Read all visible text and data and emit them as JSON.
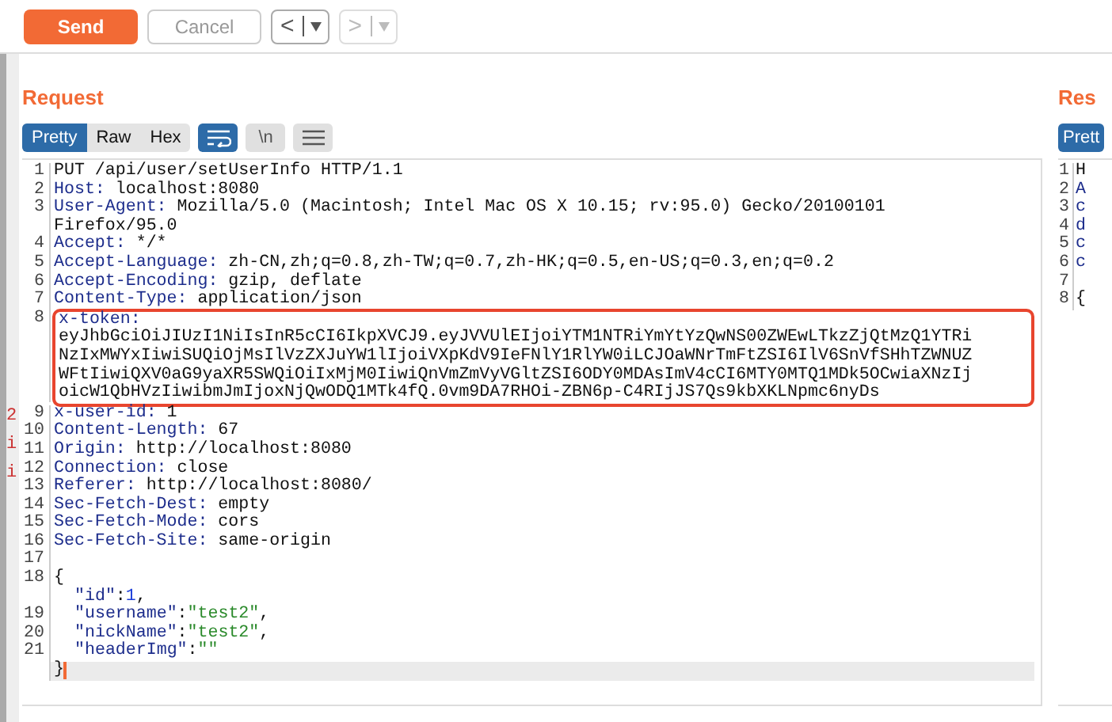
{
  "toolbar": {
    "send": {
      "label": "Send"
    },
    "cancel": {
      "label": "Cancel",
      "disabled": true
    },
    "back": {
      "label": "<",
      "disabled": false
    },
    "forward": {
      "label": ">",
      "disabled": true
    }
  },
  "edge_marks": [
    "2",
    "i",
    "i"
  ],
  "request": {
    "title": "Request",
    "tabs": [
      {
        "label": "Pretty",
        "selected": true
      },
      {
        "label": "Raw",
        "selected": false
      },
      {
        "label": "Hex",
        "selected": false
      }
    ],
    "wrap_toggle": {
      "on": true
    },
    "newline_toggle": {
      "label": "\\n",
      "on": false
    },
    "lines": [
      {
        "kind": "line",
        "number": "1",
        "parts": [
          {
            "kind": "text",
            "text": "PUT /api/user/setUserInfo HTTP/1.1"
          }
        ]
      },
      {
        "kind": "line",
        "number": "2",
        "parts": [
          {
            "kind": "key",
            "text": "Host:"
          },
          {
            "kind": "text",
            "text": " localhost:8080"
          }
        ]
      },
      {
        "kind": "line",
        "number": "3",
        "parts": [
          {
            "kind": "key",
            "text": "User-Agent:"
          },
          {
            "kind": "text",
            "text": " Mozilla/5.0 (Macintosh; Intel Mac OS X 10.15; rv:95.0) Gecko/20100101"
          }
        ]
      },
      {
        "kind": "line",
        "parts": [
          {
            "kind": "text",
            "text": "Firefox/95.0"
          }
        ]
      },
      {
        "kind": "line",
        "number": "4",
        "parts": [
          {
            "kind": "key",
            "text": "Accept:"
          },
          {
            "kind": "text",
            "text": " */*"
          }
        ]
      },
      {
        "kind": "line",
        "number": "5",
        "parts": [
          {
            "kind": "key",
            "text": "Accept-Language:"
          },
          {
            "kind": "text",
            "text": " zh-CN,zh;q=0.8,zh-TW;q=0.7,zh-HK;q=0.5,en-US;q=0.3,en;q=0.2"
          }
        ]
      },
      {
        "kind": "line",
        "number": "6",
        "parts": [
          {
            "kind": "key",
            "text": "Accept-Encoding:"
          },
          {
            "kind": "text",
            "text": " gzip, deflate"
          }
        ]
      },
      {
        "kind": "line",
        "number": "7",
        "parts": [
          {
            "kind": "key",
            "text": "Content-Type:"
          },
          {
            "kind": "text",
            "text": " application/json"
          }
        ]
      },
      {
        "kind": "boxed",
        "lines": [
          {
            "number": "8",
            "parts": [
              {
                "kind": "key",
                "text": "x-token:"
              }
            ]
          },
          {
            "parts": [
              {
                "kind": "text",
                "text": "eyJhbGciOiJIUzI1NiIsInR5cCI6IkpXVCJ9.eyJVVUlEIjoiYTM1NTRiYmYtYzQwNS00ZWEwLTkzZjQtMzQ1YTRi"
              }
            ]
          },
          {
            "parts": [
              {
                "kind": "text",
                "text": "NzIxMWYxIiwiSUQiOjMsIlVzZXJuYW1lIjoiVXpKdV9IeFNlY1RlYW0iLCJOaWNrTmFtZSI6IlV6SnVfSHhTZWNUZ"
              }
            ]
          },
          {
            "parts": [
              {
                "kind": "text",
                "text": "WFtIiwiQXV0aG9yaXR5SWQiOiIxMjM0IiwiQnVmZmVyVGltZSI6ODY0MDAsImV4cCI6MTY0MTQ1MDk5OCwiaXNzIj"
              }
            ]
          },
          {
            "parts": [
              {
                "kind": "text",
                "text": "oicW1QbHVzIiwibmJmIjoxNjQwODQ1MTk4fQ.0vm9DA7RHOi-ZBN6p-C4RIjJS7Qs9kbXKLNpmc6nyDs"
              }
            ]
          }
        ]
      },
      {
        "kind": "line",
        "number": "9",
        "parts": [
          {
            "kind": "key",
            "text": "x-user-id:"
          },
          {
            "kind": "text",
            "text": " 1"
          }
        ]
      },
      {
        "kind": "line",
        "number": "10",
        "parts": [
          {
            "kind": "key",
            "text": "Content-Length:"
          },
          {
            "kind": "text",
            "text": " 67"
          }
        ]
      },
      {
        "kind": "line",
        "number": "11",
        "parts": [
          {
            "kind": "key",
            "text": "Origin:"
          },
          {
            "kind": "text",
            "text": " http://localhost:8080"
          }
        ]
      },
      {
        "kind": "line",
        "number": "12",
        "parts": [
          {
            "kind": "key",
            "text": "Connection:"
          },
          {
            "kind": "text",
            "text": " close"
          }
        ]
      },
      {
        "kind": "line",
        "number": "13",
        "parts": [
          {
            "kind": "key",
            "text": "Referer:"
          },
          {
            "kind": "text",
            "text": " http://localhost:8080/"
          }
        ]
      },
      {
        "kind": "line",
        "number": "14",
        "parts": [
          {
            "kind": "key",
            "text": "Sec-Fetch-Dest:"
          },
          {
            "kind": "text",
            "text": " empty"
          }
        ]
      },
      {
        "kind": "line",
        "number": "15",
        "parts": [
          {
            "kind": "key",
            "text": "Sec-Fetch-Mode:"
          },
          {
            "kind": "text",
            "text": " cors"
          }
        ]
      },
      {
        "kind": "line",
        "number": "16",
        "parts": [
          {
            "kind": "key",
            "text": "Sec-Fetch-Site:"
          },
          {
            "kind": "text",
            "text": " same-origin"
          }
        ]
      },
      {
        "kind": "line",
        "number": "17"
      },
      {
        "kind": "line",
        "number": "18",
        "parts": [
          {
            "kind": "text",
            "text": "{"
          }
        ]
      },
      {
        "kind": "line",
        "indented": true,
        "parts": [
          {
            "kind": "jkey",
            "text": "\"id\""
          },
          {
            "kind": "text",
            "text": ":"
          },
          {
            "kind": "number",
            "text": "1"
          },
          {
            "kind": "text",
            "text": ","
          }
        ]
      },
      {
        "kind": "line",
        "number": "19",
        "indented": true,
        "parts": [
          {
            "kind": "jkey",
            "text": "\"username\""
          },
          {
            "kind": "text",
            "text": ":"
          },
          {
            "kind": "string",
            "text": "\"test2\""
          },
          {
            "kind": "text",
            "text": ","
          }
        ]
      },
      {
        "kind": "line",
        "number": "20",
        "indented": true,
        "parts": [
          {
            "kind": "jkey",
            "text": "\"nickName\""
          },
          {
            "kind": "text",
            "text": ":"
          },
          {
            "kind": "string",
            "text": "\"test2\""
          },
          {
            "kind": "text",
            "text": ","
          }
        ]
      },
      {
        "kind": "line",
        "number": "21",
        "indented": true,
        "parts": [
          {
            "kind": "jkey",
            "text": "\"headerImg\""
          },
          {
            "kind": "text",
            "text": ":"
          },
          {
            "kind": "string",
            "text": "\"\""
          }
        ]
      },
      {
        "kind": "line",
        "current": true,
        "parts": [
          {
            "kind": "text",
            "text": "}"
          }
        ]
      }
    ]
  },
  "response": {
    "title": "Res",
    "tabs": [
      {
        "label": "Prett",
        "selected": true
      }
    ],
    "lines": [
      {
        "number": "1",
        "parts": [
          {
            "kind": "text",
            "text": "H"
          }
        ]
      },
      {
        "number": "2",
        "parts": [
          {
            "kind": "key",
            "text": "A"
          }
        ]
      },
      {
        "number": "3",
        "parts": [
          {
            "kind": "key",
            "text": "c"
          }
        ]
      },
      {
        "number": "4",
        "parts": [
          {
            "kind": "key",
            "text": "d"
          }
        ]
      },
      {
        "number": "5",
        "parts": [
          {
            "kind": "key",
            "text": "c"
          }
        ]
      },
      {
        "number": "6",
        "parts": [
          {
            "kind": "key",
            "text": "c"
          }
        ]
      },
      {
        "number": "7"
      },
      {
        "number": "8",
        "parts": [
          {
            "kind": "text",
            "text": "{"
          }
        ]
      }
    ]
  }
}
